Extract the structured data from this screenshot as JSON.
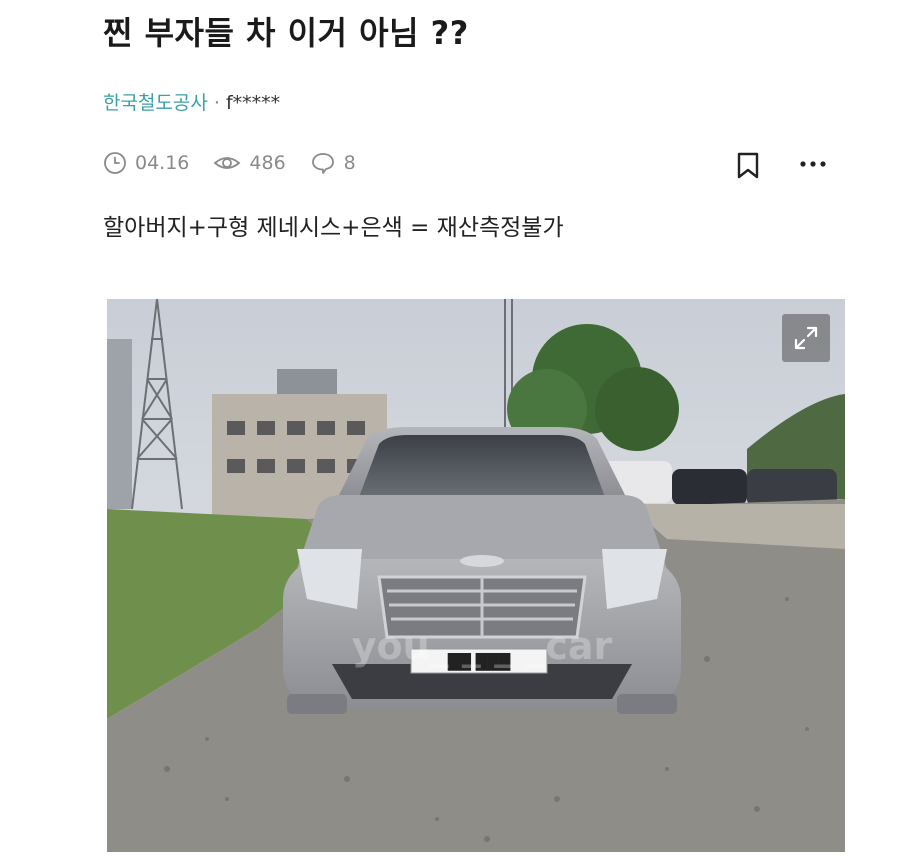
{
  "post": {
    "title": "찐 부자들 차 이거 아님 ??",
    "company": "한국철도공사",
    "separator": "·",
    "user": "f*****",
    "date": "04.16",
    "views": "486",
    "comments": "8",
    "body": "할아버지+구형 제네시스+은색 = 재산측정불가"
  },
  "photo": {
    "watermark": "you_ _ _ _car",
    "plate": "██ ███"
  },
  "icons": {
    "date": "clock-icon",
    "views": "eye-icon",
    "comments": "comment-icon",
    "bookmark": "bookmark-icon",
    "more": "more-icon",
    "expand": "expand-icon"
  }
}
